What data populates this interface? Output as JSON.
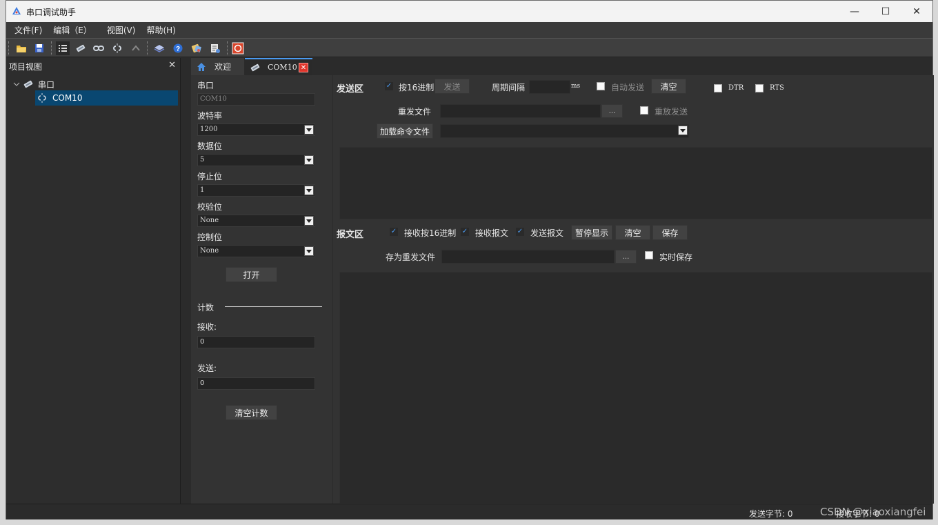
{
  "window": {
    "title": "串口调试助手",
    "minimize": "—",
    "maximize": "☐",
    "close": "✕"
  },
  "menu": [
    "文件(F)",
    "编辑（E）",
    "视图(V)",
    "帮助(H)"
  ],
  "toolbar_icons": [
    "open-folder-icon",
    "save-icon",
    "list-icon",
    "serial-port-icon",
    "connect-icon",
    "disconnect-icon",
    "undo-icon",
    "book-icon",
    "help-icon",
    "tools-icon",
    "settings-icon",
    "record-icon"
  ],
  "project": {
    "header": "项目视图",
    "close": "✕",
    "root": "串口",
    "child": "COM10"
  },
  "tabs": [
    {
      "label": "欢迎",
      "icon": "home-icon"
    },
    {
      "label": "COM10",
      "icon": "serial-port-icon",
      "close": "✕"
    }
  ],
  "settings": {
    "port_label": "串口",
    "port_value": "COM10",
    "baud_label": "波特率",
    "baud_value": "1200",
    "databits_label": "数据位",
    "databits_value": "5",
    "stopbits_label": "停止位",
    "stopbits_value": "1",
    "parity_label": "校验位",
    "parity_value": "None",
    "flow_label": "控制位",
    "flow_value": "None",
    "open_button": "打开",
    "count_label": "计数",
    "recv_label": "接收:",
    "recv_value": "0",
    "send_label": "发送:",
    "send_value": "0",
    "clear_count_button": "清空计数"
  },
  "send_area": {
    "title": "发送区",
    "hex_send": "按16进制",
    "send_button": "发送",
    "period_label": "周期间隔",
    "period_unit": "ms",
    "auto_send": "自动发送",
    "clear_button": "清空",
    "dtr": "DTR",
    "rts": "RTS",
    "resend_file_label": "重发文件",
    "browse": "...",
    "replay_send": "重放发送",
    "load_cmd_button": "加载命令文件"
  },
  "message_area": {
    "title": "报文区",
    "recv_hex": "接收按16进制",
    "recv_msg": "接收报文",
    "send_msg": "发送报文",
    "pause_button": "暂停显示",
    "clear_button": "清空",
    "save_button": "保存",
    "save_resend_label": "存为重发文件",
    "browse": "...",
    "realtime_save": "实时保存"
  },
  "status": {
    "send_bytes": "发送字节: 0",
    "recv_bytes": "接收字节: 0",
    "watermark": "CSDN @xiaoxiangfei"
  }
}
